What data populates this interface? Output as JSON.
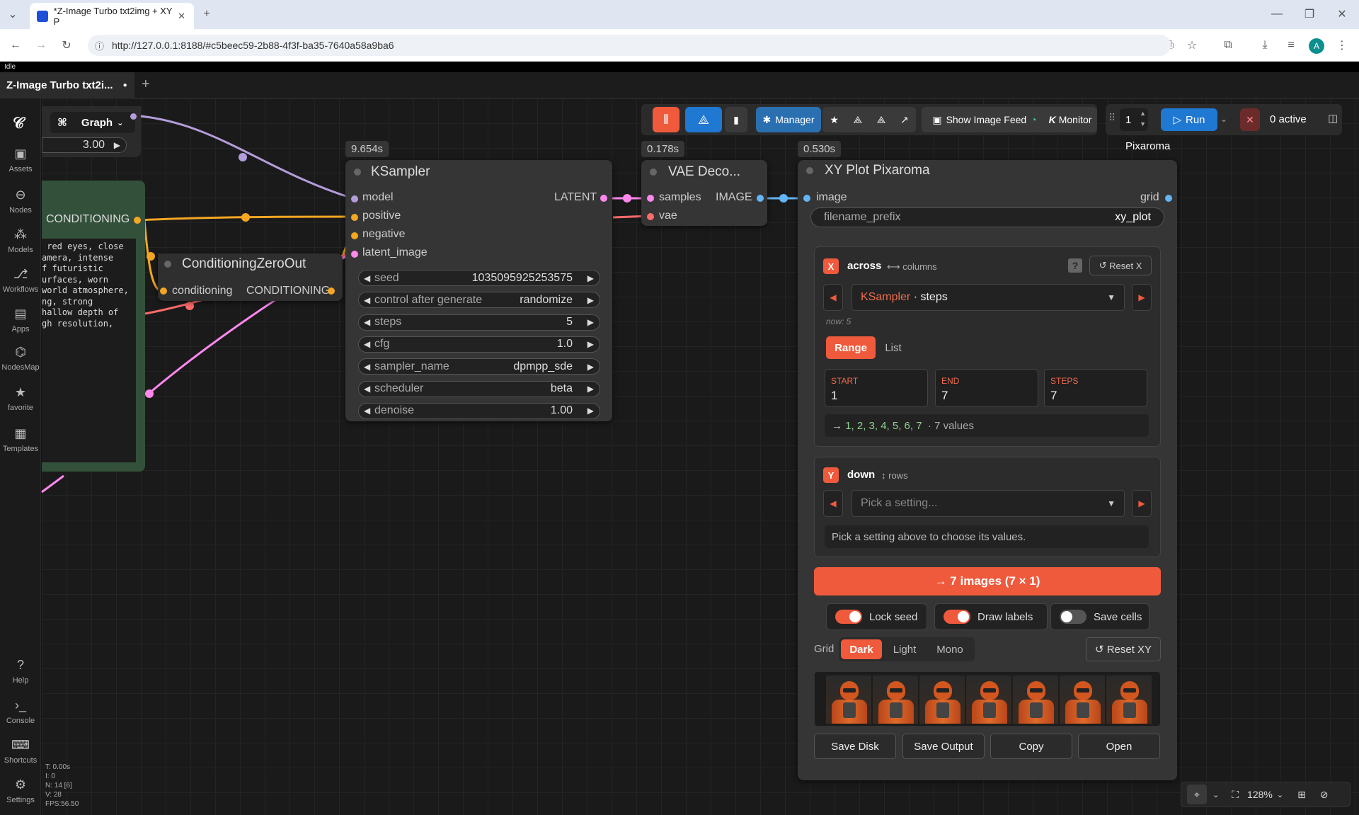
{
  "browser": {
    "tab_title": "*Z-Image Turbo txt2img + XY P",
    "url": "http://127.0.0.1:8188/#c5beec59-2b88-4f3f-ba35-7640a58a9ba6",
    "profile_initial": "A"
  },
  "app": {
    "status": "Idle",
    "workflow_tab": "Z-Image Turbo txt2i...",
    "graph_label": "Graph",
    "float_value": "3.00"
  },
  "sidebar": {
    "items": [
      {
        "label": "Assets",
        "icon": "image-icon"
      },
      {
        "label": "Nodes",
        "icon": "nodes-icon"
      },
      {
        "label": "Models",
        "icon": "models-icon"
      },
      {
        "label": "Workflows",
        "icon": "workflow-icon"
      },
      {
        "label": "Apps",
        "icon": "apps-icon"
      },
      {
        "label": "NodesMap",
        "icon": "map-icon"
      },
      {
        "label": "favorite",
        "icon": "star-icon"
      },
      {
        "label": "Templates",
        "icon": "templates-icon"
      }
    ],
    "bottom": [
      {
        "label": "Help",
        "icon": "help-icon"
      },
      {
        "label": "Console",
        "icon": "console-icon"
      },
      {
        "label": "Shortcuts",
        "icon": "keyboard-icon"
      },
      {
        "label": "Settings",
        "icon": "gear-icon"
      }
    ]
  },
  "toolbar": {
    "manager": "Manager",
    "image_feed": "Show Image Feed",
    "monitor": "Monitor",
    "queue_count": "1",
    "run": "Run",
    "active": "0 active",
    "brand": "Pixaroma"
  },
  "prompt_node": {
    "output": "CONDITIONING",
    "text_lines": [
      " red eyes, close",
      "amera, intense",
      "f futuristic",
      "urfaces, worn",
      "world atmosphere,",
      "ng, strong",
      "hallow depth of",
      "gh resolution,"
    ]
  },
  "cond_zero": {
    "title": "ConditioningZeroOut",
    "input": "conditioning",
    "output": "CONDITIONING"
  },
  "ksampler": {
    "timing": "9.654s",
    "title": "KSampler",
    "inputs": [
      "model",
      "positive",
      "negative",
      "latent_image"
    ],
    "output": "LATENT",
    "widgets": [
      {
        "label": "seed",
        "value": "1035095925253575"
      },
      {
        "label": "control after generate",
        "value": "randomize"
      },
      {
        "label": "steps",
        "value": "5"
      },
      {
        "label": "cfg",
        "value": "1.0"
      },
      {
        "label": "sampler_name",
        "value": "dpmpp_sde"
      },
      {
        "label": "scheduler",
        "value": "beta"
      },
      {
        "label": "denoise",
        "value": "1.00"
      }
    ]
  },
  "vae": {
    "timing": "0.178s",
    "title": "VAE Deco...",
    "inputs": [
      "samples",
      "vae"
    ],
    "output": "IMAGE"
  },
  "xy": {
    "timing": "0.530s",
    "title": "XY Plot Pixaroma",
    "input": "image",
    "output": "grid",
    "filename_label": "filename_prefix",
    "filename_value": "xy_plot",
    "x_axis": {
      "badge": "X",
      "name": "across",
      "hint": "columns",
      "reset": "Reset X",
      "help": "?",
      "setting_node": "KSampler",
      "setting_name": "· steps",
      "now": "now: 5",
      "mode_range": "Range",
      "mode_list": "List",
      "start_label": "START",
      "start": "1",
      "end_label": "END",
      "end": "7",
      "steps_label": "STEPS",
      "steps": "7",
      "values_preview": "1, 2, 3, 4, 5, 6, 7",
      "values_count": "· 7 values"
    },
    "y_axis": {
      "badge": "Y",
      "name": "down",
      "hint": "rows",
      "placeholder": "Pick a setting...",
      "info": "Pick a setting above to choose its values."
    },
    "generate": "→ 7 images (7 × 1)",
    "toggles": [
      {
        "label": "Lock seed",
        "on": true
      },
      {
        "label": "Draw labels",
        "on": true
      },
      {
        "label": "Save cells",
        "on": false
      }
    ],
    "grid_label": "Grid",
    "themes": [
      "Dark",
      "Light",
      "Mono"
    ],
    "active_theme": "Dark",
    "reset_xy": "Reset XY",
    "buttons": [
      "Save Disk",
      "Save Output",
      "Copy",
      "Open"
    ]
  },
  "stats": [
    "T: 0.00s",
    "I: 0",
    "N: 14 [6]",
    "V: 28",
    "FPS:56.50"
  ],
  "zoom": "128%",
  "colors": {
    "accent": "#f05a3c",
    "run": "#1f78d1",
    "model_link": "#b39ddb",
    "cond_link": "#f5a623",
    "latent_link": "#ff88ee",
    "image_link": "#64b5f6",
    "vae_link": "#ff6b6b"
  }
}
